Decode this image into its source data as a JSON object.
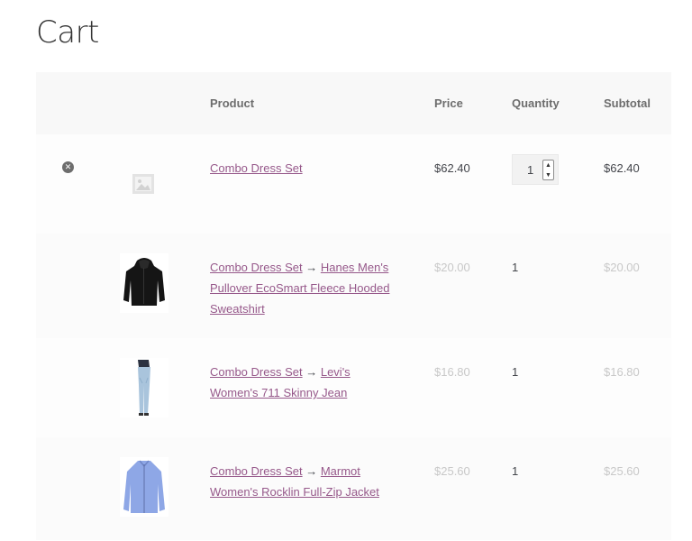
{
  "page": {
    "title": "Cart"
  },
  "table": {
    "headers": {
      "product": "Product",
      "price": "Price",
      "quantity": "Quantity",
      "subtotal": "Subtotal"
    }
  },
  "items": [
    {
      "parent": "Combo Dress Set",
      "child": "",
      "price": "$62.40",
      "quantity": "1",
      "subtotal": "$62.40",
      "image": "placeholder-icon"
    },
    {
      "parent": "Combo Dress Set",
      "arrow": "→",
      "child": "Hanes Men's Pullover EcoSmart Fleece Hooded Sweatshirt",
      "price": "$20.00",
      "quantity": "1",
      "subtotal": "$20.00",
      "image": "black-hoodie"
    },
    {
      "parent": "Combo Dress Set",
      "arrow": "→",
      "child": "Levi's Women's 711 Skinny Jean",
      "price": "$16.80",
      "quantity": "1",
      "subtotal": "$16.80",
      "image": "skinny-jeans"
    },
    {
      "parent": "Combo Dress Set",
      "arrow": "→",
      "child": "Marmot Women's Rocklin Full-Zip Jacket",
      "price": "$25.60",
      "quantity": "1",
      "subtotal": "$25.60",
      "image": "blue-jacket"
    }
  ],
  "colors": {
    "link": "#96588a",
    "text": "#43454b",
    "muted": "#c8c8c8",
    "header_bg": "#f8f8f8"
  }
}
